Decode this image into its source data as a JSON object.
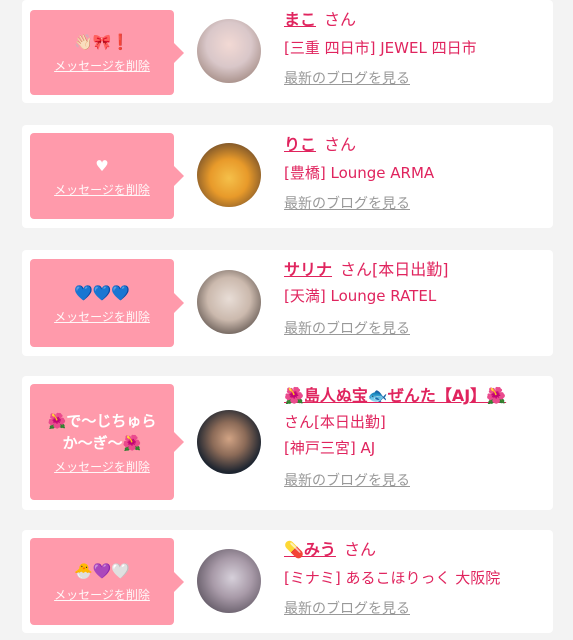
{
  "messages": [
    {
      "message": "👋🏻🎀❗",
      "delete_label": "メッセージを削除",
      "name": "まこ",
      "suffix": "さん",
      "shop": "[三重 四日市] JEWEL 四日市",
      "blog_link": "最新のブログを見る",
      "avatar_colors": [
        "#d9c7c9",
        "#8a6f63"
      ]
    },
    {
      "message": "♥",
      "delete_label": "メッセージを削除",
      "name": "りこ",
      "suffix": "さん",
      "shop": "[豊橋] Lounge ARMA",
      "blog_link": "最新のブログを見る",
      "avatar_colors": [
        "#f0b43a",
        "#3a2a2a"
      ]
    },
    {
      "message": "💙💙💙",
      "delete_label": "メッセージを削除",
      "name": "サリナ",
      "suffix": "さん[本日出勤]",
      "shop": "[天満] Lounge RATEL",
      "blog_link": "最新のブログを見る",
      "avatar_colors": [
        "#e8ddd6",
        "#2d2522"
      ]
    },
    {
      "message": "🌺で〜じちゅら\nか〜ぎ〜🌺",
      "delete_label": "メッセージを削除",
      "name": "🌺島人ぬ宝🐟ぜんた【AJ】🌺",
      "suffix": "さん[本日出勤]",
      "shop": "[神戸三宮] AJ",
      "blog_link": "最新のブログを見る",
      "avatar_colors": [
        "#1e2530",
        "#c89a7c"
      ]
    },
    {
      "message": "🐣💜🤍",
      "delete_label": "メッセージを削除",
      "name": "💊みう",
      "suffix": "さん",
      "shop": "[ミナミ] あるこほりっく 大阪院",
      "blog_link": "最新のブログを見る",
      "avatar_colors": [
        "#c9c2cf",
        "#3b3540"
      ]
    }
  ]
}
